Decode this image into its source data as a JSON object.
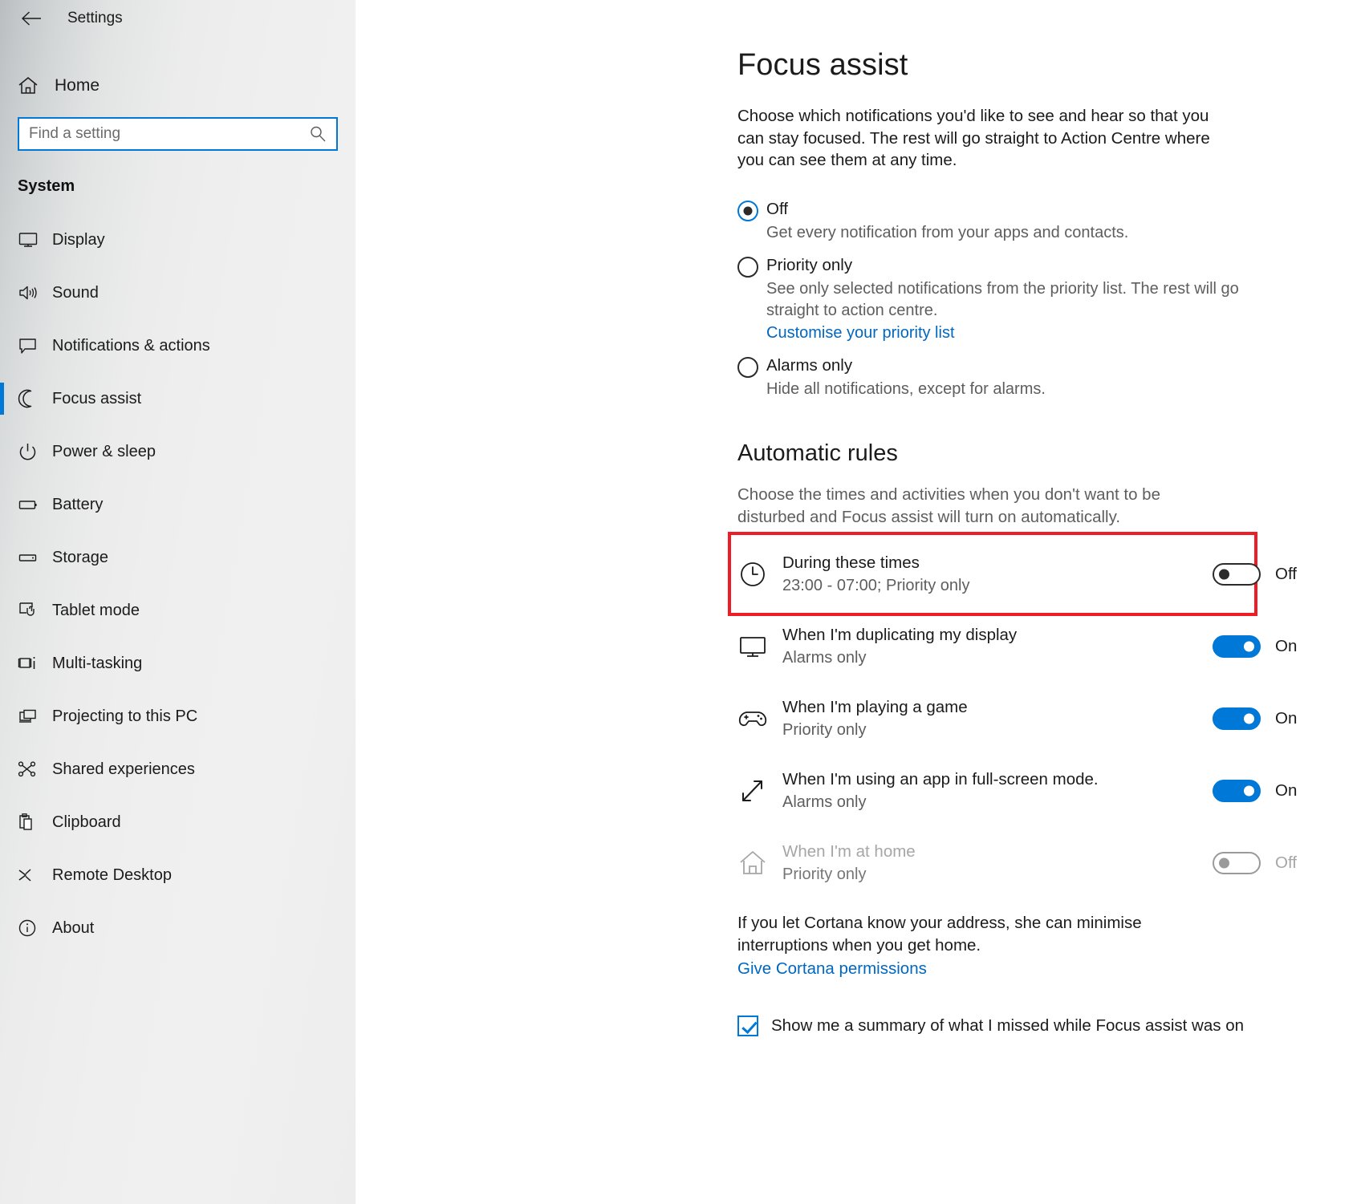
{
  "window": {
    "title": "Settings",
    "back_icon": "back-arrow-icon"
  },
  "sidebar": {
    "home_label": "Home",
    "home_icon": "home-icon",
    "search": {
      "placeholder": "Find a setting",
      "value": "",
      "icon": "search-icon"
    },
    "group_label": "System",
    "items": [
      {
        "label": "Display",
        "icon": "monitor-icon",
        "selected": false
      },
      {
        "label": "Sound",
        "icon": "speaker-icon",
        "selected": false
      },
      {
        "label": "Notifications & actions",
        "icon": "speech-bubble-icon",
        "selected": false
      },
      {
        "label": "Focus assist",
        "icon": "moon-icon",
        "selected": true
      },
      {
        "label": "Power & sleep",
        "icon": "power-icon",
        "selected": false
      },
      {
        "label": "Battery",
        "icon": "battery-icon",
        "selected": false
      },
      {
        "label": "Storage",
        "icon": "drive-icon",
        "selected": false
      },
      {
        "label": "Tablet mode",
        "icon": "tablet-touch-icon",
        "selected": false
      },
      {
        "label": "Multi-tasking",
        "icon": "multitask-icon",
        "selected": false
      },
      {
        "label": "Projecting to this PC",
        "icon": "project-screen-icon",
        "selected": false
      },
      {
        "label": "Shared experiences",
        "icon": "share-nodes-icon",
        "selected": false
      },
      {
        "label": "Clipboard",
        "icon": "clipboard-icon",
        "selected": false
      },
      {
        "label": "Remote Desktop",
        "icon": "remote-desktop-icon",
        "selected": false
      },
      {
        "label": "About",
        "icon": "info-circle-icon",
        "selected": false
      }
    ]
  },
  "main": {
    "page_title": "Focus assist",
    "intro": "Choose which notifications you'd like to see and hear so that you can stay focused. The rest will go straight to Action Centre where you can see them at any time.",
    "modes": [
      {
        "label": "Off",
        "description": "Get every notification from your apps and contacts.",
        "selected": true,
        "link": ""
      },
      {
        "label": "Priority only",
        "description": "See only selected notifications from the priority list. The rest will go straight to action centre.",
        "selected": false,
        "link": "Customise your priority list"
      },
      {
        "label": "Alarms only",
        "description": "Hide all notifications, except for alarms.",
        "selected": false,
        "link": ""
      }
    ],
    "automatic_rules": {
      "title": "Automatic rules",
      "description": "Choose the times and activities when you don't want to be disturbed and Focus assist will turn on automatically.",
      "rules": [
        {
          "title": "During these times",
          "subtitle": "23:00 - 07:00; Priority only",
          "icon": "clock-icon",
          "state": "Off",
          "on": false,
          "disabled": false,
          "highlighted": true
        },
        {
          "title": "When I'm duplicating my display",
          "subtitle": "Alarms only",
          "icon": "monitor-icon",
          "state": "On",
          "on": true,
          "disabled": false,
          "highlighted": false
        },
        {
          "title": "When I'm playing a game",
          "subtitle": "Priority only",
          "icon": "gamepad-icon",
          "state": "On",
          "on": true,
          "disabled": false,
          "highlighted": false
        },
        {
          "title": "When I'm using an app in full-screen mode.",
          "subtitle": "Alarms only",
          "icon": "fullscreen-arrows-icon",
          "state": "On",
          "on": true,
          "disabled": false,
          "highlighted": false
        },
        {
          "title": "When I'm at home",
          "subtitle": "Priority only",
          "icon": "house-icon",
          "state": "Off",
          "on": false,
          "disabled": true,
          "highlighted": false
        }
      ]
    },
    "cortana_note": "If you let Cortana know your address, she can minimise interruptions when you get home.",
    "cortana_link": "Give Cortana permissions",
    "summary_checkbox": {
      "label": "Show me a summary of what I missed while Focus assist was on",
      "checked": true
    }
  },
  "colors": {
    "accent": "#0078d7",
    "link": "#0067c0",
    "highlight": "#ee1c25",
    "text": "#1b1b1b",
    "muted": "#5e5e5e",
    "disabled": "#a6a6a6"
  }
}
